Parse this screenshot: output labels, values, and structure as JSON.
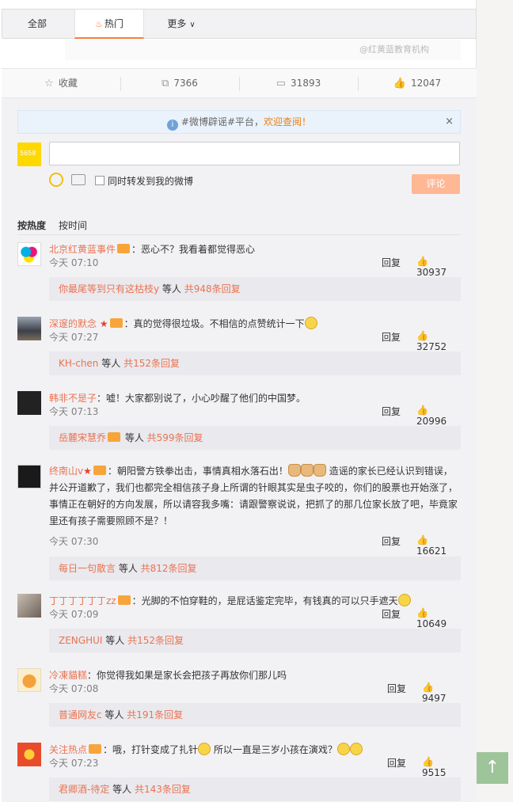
{
  "tabs": {
    "all": "全部",
    "hot": "热门",
    "more": "更多"
  },
  "watermark": "@红黄蓝教育机构",
  "actions": {
    "fav": "收藏",
    "repost": "7366",
    "comment": "31893",
    "like": "12047"
  },
  "notice": {
    "text": "#微博辟谣#平台，",
    "link": "欢迎查阅！",
    "close": "×"
  },
  "composer": {
    "avatar_text": "5658",
    "repost_label": "同时转发到我的微博",
    "submit": "评论"
  },
  "sort": {
    "by_hot": "按热度",
    "by_time": "按时间"
  },
  "comments": [
    {
      "user": "北京红黄蓝事件",
      "text": "：恶心不？我看着都觉得恶心",
      "time": "今天 07:10",
      "likes": "30937",
      "sub_name": "你最尾等到只有这枯枝y",
      "sub_mid": " 等人 ",
      "sub_count": "共948条回复",
      "avatar_color": "#e8e8e8"
    },
    {
      "user": "深邃的默念",
      "text": "：真的觉得很垃圾。不相信的点赞统计一下",
      "time": "今天 07:27",
      "likes": "32752",
      "sub_name": "KH-chen",
      "sub_mid": " 等人 ",
      "sub_count": "共152条回复",
      "avatar_color": "#6c7078"
    },
    {
      "user": "韩非不是子",
      "text": "：嘘！大家都别说了，小心吵醒了他们的中国梦。",
      "time": "今天 07:13",
      "likes": "20996",
      "sub_name": "岳麓宋慧乔",
      "sub_mid": " 等人 ",
      "sub_count": "共599条回复",
      "avatar_color": "#2a2a2a"
    },
    {
      "user": "终南山v",
      "text": "：朝阳警方铁拳出击，事情真相水落石出！",
      "text2": "造谣的家长已经认识到错误，并公开道歉了，我们也都完全相信孩子身上所谓的针眼其实是虫子咬的，你们的股票也开始涨了，事情正在朝好的方向发展，所以请容我多嘴：请跟警察说说，把抓了的那几位家长放了吧，毕竟家里还有孩子需要照顾不是？！",
      "time": "今天 07:30",
      "likes": "16621",
      "sub_name": "每日一句散言",
      "sub_mid": " 等人 ",
      "sub_count": "共812条回复",
      "avatar_color": "#1c1c1c"
    },
    {
      "user": "丁丁丁丁丁丁zz",
      "text": "：光脚的不怕穿鞋的，是屁话鉴定完毕，有钱真的可以只手遮天",
      "time": "今天 07:09",
      "likes": "10649",
      "sub_name": "ZENGHUI",
      "sub_mid": " 等人 ",
      "sub_count": "共152条回复",
      "avatar_color": "#7a6e66"
    },
    {
      "user": "冷凍貓糕",
      "text": "：你觉得我如果是家长会把孩子再放你们那儿吗",
      "time": "今天 07:08",
      "likes": "9497",
      "sub_name": "普通网友c",
      "sub_mid": " 等人 ",
      "sub_count": "共191条回复",
      "avatar_color": "#f3e9d0"
    },
    {
      "user": "关注热点",
      "text": "：哦，打针变成了扎针",
      "text2": "所以一直是三岁小孩在演戏？",
      "time": "今天 07:23",
      "likes": "9515",
      "sub_name": "君卿酒-待定",
      "sub_mid": " 等人 ",
      "sub_count": "共143条回复",
      "avatar_color": "#e94b2b"
    }
  ],
  "reply_label": "回复",
  "backtop": "↑"
}
